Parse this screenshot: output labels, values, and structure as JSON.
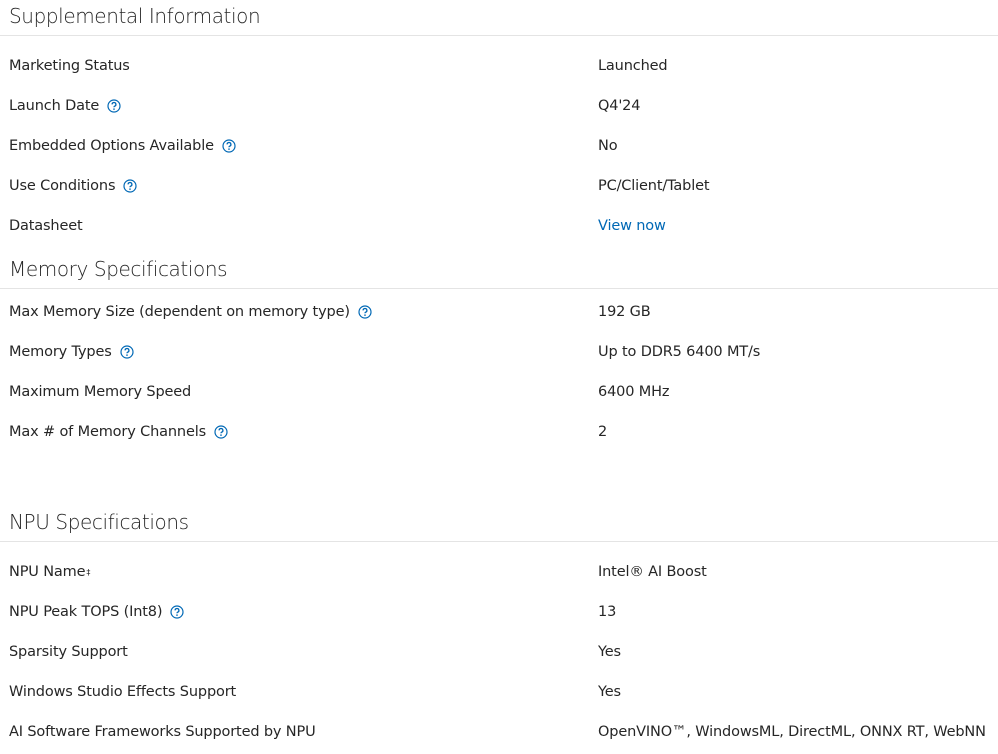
{
  "colors": {
    "link": "#0068b5",
    "help_icon": "#0068b5",
    "divider": "#e4e4e4",
    "text": "#262626"
  },
  "sections": [
    {
      "title": "Supplemental Information",
      "rows": [
        {
          "label": "Marketing Status",
          "value": "Launched"
        },
        {
          "label": "Launch Date",
          "value": "Q4'24",
          "help_icon": "question-circle-icon"
        },
        {
          "label": "Embedded Options Available",
          "value": "No",
          "help_icon": "question-circle-icon"
        },
        {
          "label": "Use Conditions",
          "value": "PC/Client/Tablet",
          "help_icon": "question-circle-icon"
        },
        {
          "label": "Datasheet",
          "value": "View now",
          "is_link": true
        }
      ]
    },
    {
      "title": "Memory Specifications",
      "rows": [
        {
          "label": "Max Memory Size (dependent on memory type)",
          "value": "192 GB",
          "help_icon": "question-circle-icon"
        },
        {
          "label": "Memory Types",
          "value": "Up to DDR5 6400 MT/s",
          "help_icon": "question-circle-icon"
        },
        {
          "label": "Maximum Memory Speed",
          "value": "6400 MHz"
        },
        {
          "label": "Max # of Memory Channels",
          "value": "2",
          "help_icon": "question-circle-icon"
        }
      ]
    },
    {
      "title": "NPU Specifications",
      "rows": [
        {
          "label": "NPU Name",
          "label_mark": "‡",
          "value": "Intel® AI Boost"
        },
        {
          "label": "NPU Peak TOPS (Int8)",
          "value": "13",
          "help_icon": "question-circle-icon"
        },
        {
          "label": "Sparsity Support",
          "value": "Yes"
        },
        {
          "label": "Windows Studio Effects Support",
          "value": "Yes"
        },
        {
          "label": "AI Software Frameworks Supported by NPU",
          "value": "OpenVINO™, WindowsML, DirectML, ONNX RT, WebNN"
        }
      ]
    }
  ]
}
